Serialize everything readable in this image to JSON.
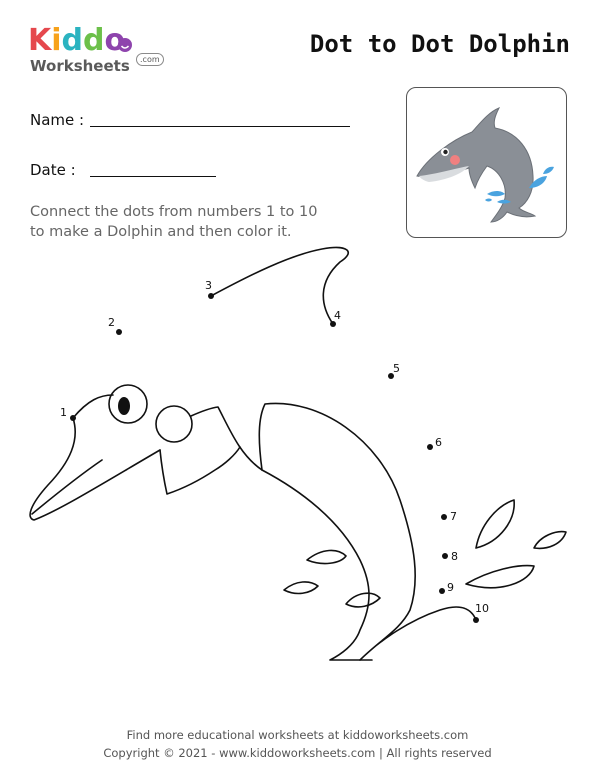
{
  "logo": {
    "letters": [
      "K",
      "i",
      "d",
      "d",
      "o"
    ],
    "letter_colors": [
      "#e5484d",
      "#f7a21b",
      "#2bb3c0",
      "#6cc04a",
      "#8e44ad"
    ],
    "subtext": "Worksheets",
    "domain_badge": ".com"
  },
  "title": "Dot to Dot Dolphin",
  "form": {
    "name_label": "Name :",
    "date_label": "Date :"
  },
  "instructions": {
    "line1": "Connect the dots from numbers 1 to 10",
    "line2": "to make a Dolphin and then color it."
  },
  "reference_image": {
    "subject": "dolphin-color-picture",
    "colors": {
      "body": "#8a8f96",
      "belly": "#d9dcdf",
      "cheek": "#f08080",
      "splash": "#4aa3df"
    }
  },
  "dots": {
    "d1": "1",
    "d2": "2",
    "d3": "3",
    "d4": "4",
    "d5": "5",
    "d6": "6",
    "d7": "7",
    "d8": "8",
    "d9": "9",
    "d10": "10"
  },
  "footer": {
    "line1": "Find more educational worksheets at kiddoworksheets.com",
    "line2": "Copyright © 2021 - www.kiddoworksheets.com  |  All rights reserved"
  }
}
